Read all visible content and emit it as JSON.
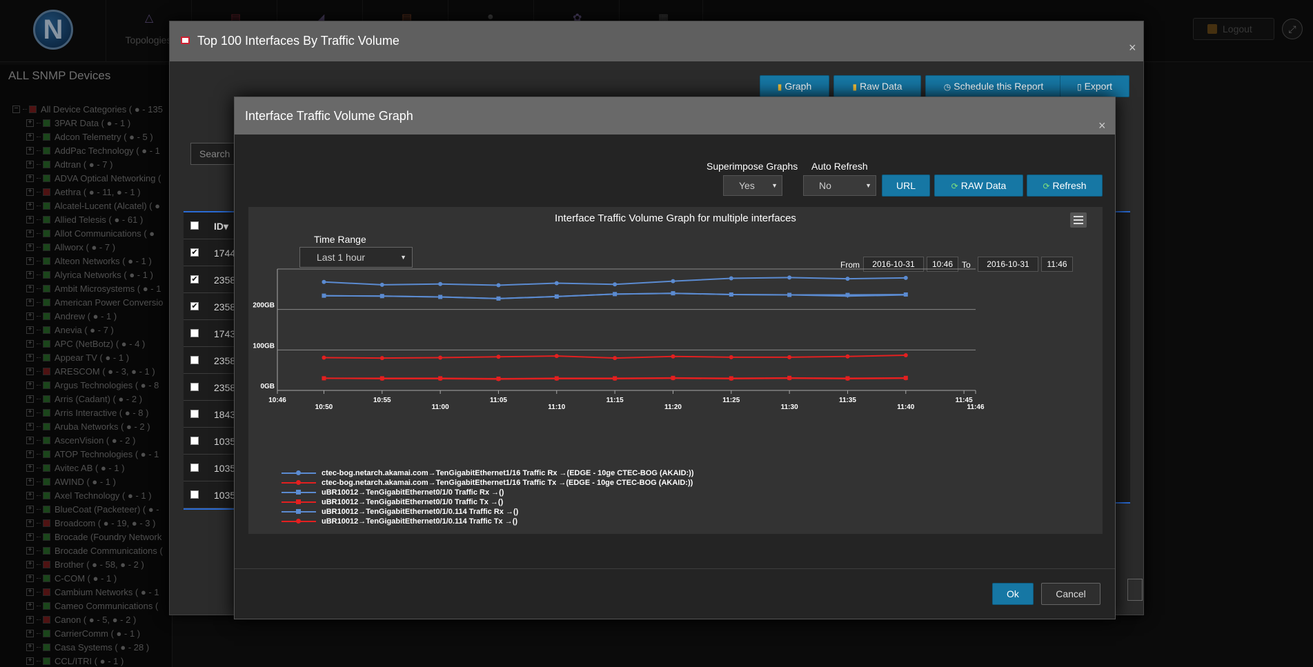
{
  "nav": {
    "logo_letter": "N",
    "tabs": [
      {
        "label": "Topologies"
      },
      {
        "label": ""
      },
      {
        "label": ""
      },
      {
        "label": ""
      },
      {
        "label": ""
      },
      {
        "label": ""
      },
      {
        "label": ""
      }
    ],
    "logout": "Logout"
  },
  "sidebar": {
    "title": "ALL SNMP Devices",
    "root": "All Device Categories ( ● - 135",
    "items": [
      {
        "label": "3PAR Data ( ● - 1 )",
        "status": "green"
      },
      {
        "label": "Adcon Telemetry ( ● - 5 )",
        "status": "green"
      },
      {
        "label": "AddPac Technology ( ● - 1",
        "status": "green"
      },
      {
        "label": "Adtran ( ● - 7 )",
        "status": "green"
      },
      {
        "label": "ADVA Optical Networking (",
        "status": "green"
      },
      {
        "label": "Aethra ( ● - 11, ● - 1 )",
        "status": "red"
      },
      {
        "label": "Alcatel-Lucent (Alcatel) ( ●",
        "status": "green"
      },
      {
        "label": "Allied Telesis ( ● - 61 )",
        "status": "green"
      },
      {
        "label": "Allot Communications ( ●",
        "status": "green"
      },
      {
        "label": "Allworx ( ● - 7 )",
        "status": "green"
      },
      {
        "label": "Alteon Networks ( ● - 1 )",
        "status": "green"
      },
      {
        "label": "Alyrica Networks ( ● - 1 )",
        "status": "green"
      },
      {
        "label": "Ambit Microsystems ( ● - 1",
        "status": "green"
      },
      {
        "label": "American Power Conversio",
        "status": "green"
      },
      {
        "label": "Andrew ( ● - 1 )",
        "status": "green"
      },
      {
        "label": "Anevia ( ● - 7 )",
        "status": "green"
      },
      {
        "label": "APC (NetBotz) ( ● - 4 )",
        "status": "green"
      },
      {
        "label": "Appear TV ( ● - 1 )",
        "status": "green"
      },
      {
        "label": "ARESCOM ( ● - 3, ● - 1 )",
        "status": "red"
      },
      {
        "label": "Argus Technologies ( ● - 8",
        "status": "green"
      },
      {
        "label": "Arris (Cadant) ( ● - 2 )",
        "status": "green"
      },
      {
        "label": "Arris Interactive ( ● - 8 )",
        "status": "green"
      },
      {
        "label": "Aruba Networks ( ● - 2 )",
        "status": "green"
      },
      {
        "label": "AscenVision ( ● - 2 )",
        "status": "green"
      },
      {
        "label": "ATOP Technologies ( ● - 1",
        "status": "green"
      },
      {
        "label": "Avitec AB ( ● - 1 )",
        "status": "green"
      },
      {
        "label": "AWIND ( ● - 1 )",
        "status": "green"
      },
      {
        "label": "Axel Technology ( ● - 1 )",
        "status": "green"
      },
      {
        "label": "BlueCoat (Packeteer) ( ● -",
        "status": "green"
      },
      {
        "label": "Broadcom ( ● - 19, ● - 3 )",
        "status": "red"
      },
      {
        "label": "Brocade (Foundry Network",
        "status": "green"
      },
      {
        "label": "Brocade Communications (",
        "status": "green"
      },
      {
        "label": "Brother ( ● - 58, ● - 2 )",
        "status": "red"
      },
      {
        "label": "C-COM ( ● - 1 )",
        "status": "green"
      },
      {
        "label": "Cambium Networks ( ● - 1",
        "status": "red"
      },
      {
        "label": "Cameo Communications (",
        "status": "green"
      },
      {
        "label": "Canon ( ● - 5, ● - 2 )",
        "status": "red"
      },
      {
        "label": "CarrierComm ( ● - 1 )",
        "status": "green"
      },
      {
        "label": "Casa Systems ( ● - 28 )",
        "status": "green"
      },
      {
        "label": "CCL/ITRI ( ● - 1 )",
        "status": "green"
      }
    ]
  },
  "report_dialog": {
    "title": "Top 100 Interfaces By Traffic Volume",
    "buttons": {
      "graph": "Graph",
      "raw_data": "Raw Data",
      "schedule": "Schedule this Report",
      "export": "Export"
    },
    "search_placeholder": "Search",
    "table": {
      "id_header": "ID",
      "rows": [
        {
          "checked": true,
          "id": "1744"
        },
        {
          "checked": true,
          "id": "2358"
        },
        {
          "checked": true,
          "id": "2358"
        },
        {
          "checked": false,
          "id": "1743"
        },
        {
          "checked": false,
          "id": "2358"
        },
        {
          "checked": false,
          "id": "2358"
        },
        {
          "checked": false,
          "id": "1843"
        },
        {
          "checked": false,
          "id": "1035"
        },
        {
          "checked": false,
          "id": "1035"
        },
        {
          "checked": false,
          "id": "1035"
        }
      ]
    }
  },
  "graph_dialog": {
    "title": "Interface Traffic Volume Graph",
    "superimpose_label": "Superimpose Graphs",
    "superimpose_value": "Yes",
    "auto_refresh_label": "Auto Refresh",
    "auto_refresh_value": "No",
    "url_button": "URL",
    "raw_data_button": "RAW Data",
    "refresh_button": "Refresh",
    "time_range_label": "Time Range",
    "time_range_value": "Last 1 hour",
    "from_label": "From",
    "from_date": "2016-10-31",
    "from_time": "10:46",
    "to_label": "To",
    "to_date": "2016-10-31",
    "to_time": "11:46",
    "ok_button": "Ok",
    "cancel_button": "Cancel",
    "colors": {
      "blue": "#5b8bd1",
      "red": "#e32020"
    }
  },
  "chart_data": {
    "type": "line",
    "title": "Interface Traffic Volume Graph for multiple interfaces",
    "xlabel": "",
    "ylabel": "",
    "y_unit": "GB",
    "y_ticks": [
      {
        "value": 0,
        "label": "0GB"
      },
      {
        "value": 100,
        "label": "100GB"
      },
      {
        "value": 200,
        "label": "200GB"
      }
    ],
    "ylim": [
      0,
      300
    ],
    "x_ticks": [
      {
        "t": 0,
        "label": "10:46",
        "row": 1
      },
      {
        "t": 4,
        "label": "10:50",
        "row": 2
      },
      {
        "t": 9,
        "label": "10:55",
        "row": 1
      },
      {
        "t": 14,
        "label": "11:00",
        "row": 2
      },
      {
        "t": 19,
        "label": "11:05",
        "row": 1
      },
      {
        "t": 24,
        "label": "11:10",
        "row": 2
      },
      {
        "t": 29,
        "label": "11:15",
        "row": 1
      },
      {
        "t": 34,
        "label": "11:20",
        "row": 2
      },
      {
        "t": 39,
        "label": "11:25",
        "row": 1
      },
      {
        "t": 44,
        "label": "11:30",
        "row": 2
      },
      {
        "t": 49,
        "label": "11:35",
        "row": 1
      },
      {
        "t": 54,
        "label": "11:40",
        "row": 2
      },
      {
        "t": 59,
        "label": "11:45",
        "row": 1
      },
      {
        "t": 60,
        "label": "11:46",
        "row": 2
      }
    ],
    "xlim": [
      0,
      60
    ],
    "x": [
      4,
      9,
      14,
      19,
      24,
      29,
      34,
      39,
      44,
      49,
      54
    ],
    "series": [
      {
        "name": "ctec-bog.netarch.akamai.com→TenGigabitEthernet1/16 Traffic Rx →(EDGE - 10ge CTEC-BOG (AKAID:))",
        "color": "#5b8bd1",
        "marker": "circle",
        "values": [
          268,
          261,
          263,
          260,
          265,
          262,
          270,
          277,
          279,
          276,
          278
        ]
      },
      {
        "name": "ctec-bog.netarch.akamai.com→TenGigabitEthernet1/16 Traffic Tx →(EDGE - 10ge CTEC-BOG (AKAID:))",
        "color": "#e32020",
        "marker": "circle",
        "values": [
          81,
          80,
          81,
          83,
          85,
          80,
          84,
          82,
          82,
          84,
          87
        ]
      },
      {
        "name": "uBR10012→TenGigabitEthernet0/1/0 Traffic Rx →()",
        "color": "#5b8bd1",
        "marker": "square",
        "values": [
          234,
          233,
          231,
          227,
          232,
          238,
          240,
          237,
          236,
          236,
          237
        ]
      },
      {
        "name": "uBR10012→TenGigabitEthernet0/1/0 Traffic Tx →()",
        "color": "#e32020",
        "marker": "square",
        "values": [
          30,
          30,
          30,
          29,
          30,
          30,
          31,
          30,
          31,
          30,
          31
        ]
      },
      {
        "name": "uBR10012→TenGigabitEthernet0/1/0.114 Traffic Rx →()",
        "color": "#5b8bd1",
        "marker": "triangle",
        "values": [
          234,
          233,
          231,
          227,
          232,
          238,
          240,
          237,
          236,
          233,
          236
        ]
      },
      {
        "name": "uBR10012→TenGigabitEthernet0/1/0.114 Traffic Tx →()",
        "color": "#e32020",
        "marker": "circle",
        "values": [
          30,
          29,
          29,
          28,
          29,
          29,
          30,
          29,
          30,
          29,
          30
        ]
      }
    ],
    "grid": true,
    "legend_position": "bottom-left"
  }
}
